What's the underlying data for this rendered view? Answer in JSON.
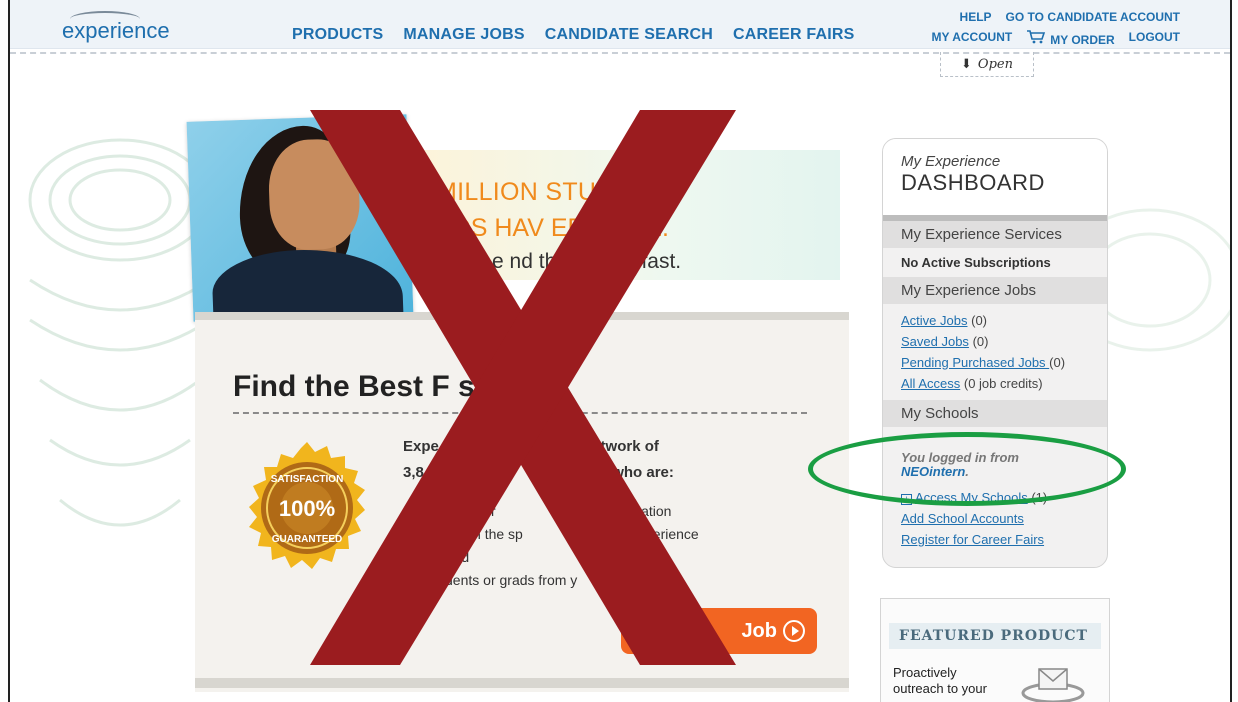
{
  "header": {
    "logo": "experience",
    "nav": [
      "PRODUCTS",
      "MANAGE JOBS",
      "CANDIDATE SEARCH",
      "CAREER FAIRS"
    ],
    "util_top": [
      "HELP",
      "GO TO CANDIDATE ACCOUNT"
    ],
    "util_bottom": {
      "my_account": "MY ACCOUNT",
      "my_order": "MY ORDER",
      "logout": "LOGOUT"
    },
    "open_tab": "Open"
  },
  "hero": {
    "line1": "MILLION STU     S AND",
    "line2": "ADS HAV    ERIENCE.",
    "line3": "ake it e       nd the best fit fast."
  },
  "main": {
    "title": "Find the Best F      st.",
    "badge": {
      "top": "SATISFACTION",
      "value": "100%",
      "bottom": "GUARANTEED"
    },
    "pitch1": "Expe                 our entire network of",
    "pitch2": "3,8            ls to          ndidates who are:",
    "bullets": [
      "I      ted in your               function or location",
      "      ified with the sp            and work experience",
      "      u need",
      "      students or grads from y             schools"
    ],
    "post_button": "Job"
  },
  "dashboard": {
    "subtitle": "My Experience",
    "title": "DASHBOARD",
    "services_header": "My Experience Services",
    "no_subscriptions": "No Active Subscriptions",
    "jobs_header": "My Experience Jobs",
    "active_jobs": "Active Jobs",
    "active_jobs_count": "(0)",
    "saved_jobs": "Saved Jobs",
    "saved_jobs_count": "(0)",
    "pending_jobs": "Pending Purchased Jobs ",
    "pending_jobs_count": "(0)",
    "all_access": "All Access",
    "all_access_credits": "(0 job credits)",
    "schools_header": "My Schools",
    "logged_in_from": "You logged in from",
    "school_name": "NEOintern",
    "access_schools": "Access My Schools",
    "access_schools_count": "(1)",
    "add_school": "Add School Accounts",
    "register_fairs": "Register for Career Fairs"
  },
  "featured": {
    "header": "FEATURED PRODUCT",
    "text": "Proactively outreach to your"
  },
  "colors": {
    "nav": "#1f6fae",
    "orange": "#f08a1c",
    "x_mark": "#9b1c1f",
    "highlight": "#1a9e43"
  }
}
